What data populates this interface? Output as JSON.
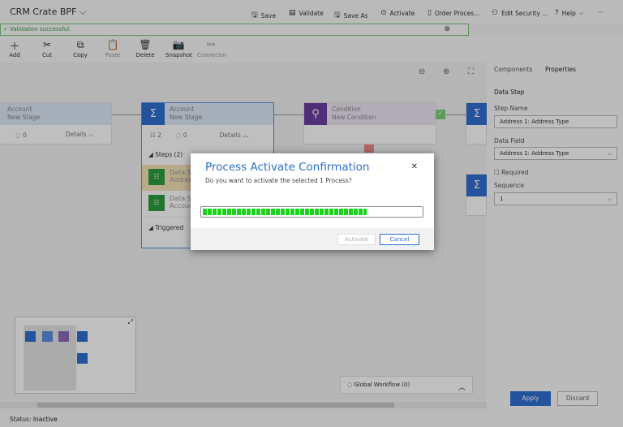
{
  "app": {
    "title": "CRM Crate BPF"
  },
  "commands": [
    {
      "label": "Save",
      "icon": "save-icon"
    },
    {
      "label": "Validate",
      "icon": "validate-icon"
    },
    {
      "label": "Save As",
      "icon": "save-as-icon"
    },
    {
      "label": "Activate",
      "icon": "activate-icon"
    },
    {
      "label": "Order Proces...",
      "icon": "order-icon"
    },
    {
      "label": "Edit Security ...",
      "icon": "security-icon"
    },
    {
      "label": "Help",
      "icon": "help-icon"
    }
  ],
  "validation": {
    "message": "Validation successful."
  },
  "ribbon": [
    {
      "label": "Add"
    },
    {
      "label": "Cut"
    },
    {
      "label": "Copy"
    },
    {
      "label": "Paste"
    },
    {
      "label": "Delete"
    },
    {
      "label": "Snapshot"
    },
    {
      "label": "Connector"
    }
  ],
  "stages": {
    "left": {
      "entity": "Account",
      "name": "New Stage",
      "count": "0",
      "details": "Details"
    },
    "selected": {
      "entity": "Account",
      "name": "New Stage",
      "steps_count": "2",
      "count": "0",
      "details": "Details",
      "steps_header": "Steps (2)",
      "step1_title": "Data St",
      "step1_sub": "Addres",
      "step2_title": "Data St",
      "step2_sub": "Accoun",
      "triggered": "Triggered"
    },
    "condition": {
      "entity": "Condition",
      "name": "New Condition"
    }
  },
  "global_workflow": {
    "label": "Global Workflow (0)"
  },
  "panel": {
    "tabs": [
      "Components",
      "Properties"
    ],
    "section": "Data Step",
    "step_name_label": "Step Name",
    "step_name": "Address 1: Address Type",
    "data_field_label": "Data Field",
    "data_field": "Address 1: Address Type",
    "required_label": "Required",
    "sequence_label": "Sequence",
    "sequence": "1",
    "apply": "Apply",
    "discard": "Discard"
  },
  "status": {
    "label": "Status:",
    "value": "Inactive"
  },
  "dialog": {
    "title": "Process Activate Confirmation",
    "message": "Do you want to activate the selected 1 Process?",
    "progress_percent": 75,
    "activate": "Activate",
    "cancel": "Cancel"
  }
}
